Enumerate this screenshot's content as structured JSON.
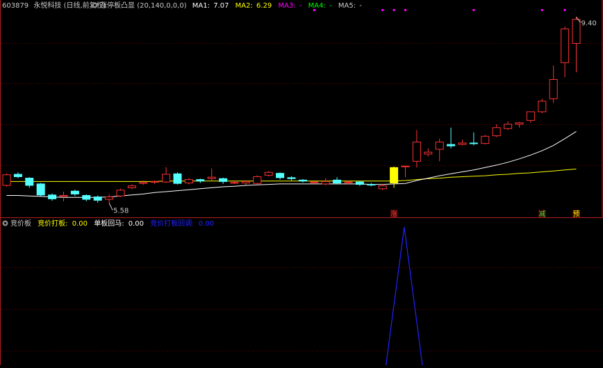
{
  "header": {
    "stock_code": "603879",
    "stock_name": "永悦科技",
    "period": "(日线,前复权)",
    "indicator_name": "涨停板凸显",
    "indicator_params": "(20,140,0,0,0)",
    "ma": [
      {
        "label": "MA1:",
        "value": "7.07",
        "color": "#ffffff"
      },
      {
        "label": "MA2:",
        "value": "6.29",
        "color": "#ffff00"
      },
      {
        "label": "MA3:",
        "value": "-",
        "color": "#ff00ff"
      },
      {
        "label": "MA4:",
        "value": "-",
        "color": "#00ff00"
      },
      {
        "label": "MA5:",
        "value": "-",
        "color": "#cccccc"
      }
    ]
  },
  "sub_header": {
    "name": "竞价板",
    "items": [
      {
        "label": "竞价打板:",
        "value": "0.00",
        "color": "#ffff00"
      },
      {
        "label": "单板回马:",
        "value": "0.00",
        "color": "#ffffff"
      },
      {
        "label": "竞价打板回调:",
        "value": "0.00",
        "color": "#2222ff"
      }
    ]
  },
  "colors": {
    "up": "#ff3232",
    "down": "#54ffff",
    "ma1": "#ffffff",
    "ma2": "#ffff00",
    "highlight": "#ffff00",
    "signal_line": "#2222ff",
    "panel_border": "#b41e1e",
    "grid": "#7a0000",
    "marker": "#ff00ff"
  },
  "chart_data": [
    {
      "type": "candlestick",
      "ylim": [
        5.3,
        9.6
      ],
      "annotations": {
        "low_label": "5.58",
        "high_label": "9.40"
      },
      "candles": [
        [
          5.95,
          6.17,
          5.92,
          6.2
        ],
        [
          6.18,
          6.13,
          6.1,
          6.22
        ],
        [
          6.1,
          5.95,
          5.9,
          6.12
        ],
        [
          5.98,
          5.75,
          5.72,
          6.0
        ],
        [
          5.75,
          5.67,
          5.63,
          5.78
        ],
        [
          5.72,
          5.74,
          5.62,
          5.82
        ],
        [
          5.83,
          5.77,
          5.73,
          5.86
        ],
        [
          5.74,
          5.66,
          5.62,
          5.76
        ],
        [
          5.71,
          5.64,
          5.59,
          5.74
        ],
        [
          5.66,
          5.71,
          5.58,
          5.76
        ],
        [
          5.73,
          5.85,
          5.71,
          5.88
        ],
        [
          5.9,
          5.94,
          5.87,
          5.97
        ],
        [
          5.99,
          6.01,
          5.96,
          6.05
        ],
        [
          6.02,
          6.03,
          5.98,
          6.05
        ],
        [
          6.02,
          6.18,
          6.0,
          6.33
        ],
        [
          6.19,
          5.99,
          5.97,
          6.22
        ],
        [
          6.0,
          6.07,
          5.97,
          6.1
        ],
        [
          6.07,
          6.04,
          6.0,
          6.09
        ],
        [
          6.09,
          6.12,
          6.05,
          6.3
        ],
        [
          6.09,
          6.03,
          5.98,
          6.11
        ],
        [
          6.01,
          6.01,
          5.98,
          6.04
        ],
        [
          6.0,
          6.03,
          5.96,
          6.05
        ],
        [
          5.99,
          6.13,
          5.97,
          6.16
        ],
        [
          6.16,
          6.22,
          6.13,
          6.25
        ],
        [
          6.2,
          6.11,
          6.07,
          6.22
        ],
        [
          6.11,
          6.09,
          6.05,
          6.14
        ],
        [
          6.06,
          6.04,
          6.01,
          6.08
        ],
        [
          6.01,
          6.02,
          5.98,
          6.03
        ],
        [
          5.98,
          6.03,
          5.95,
          6.1
        ],
        [
          6.06,
          6.0,
          5.97,
          6.12
        ],
        [
          6.01,
          6.02,
          5.97,
          6.04
        ],
        [
          6.02,
          5.97,
          5.94,
          6.04
        ],
        [
          5.97,
          5.96,
          5.93,
          6.0
        ],
        [
          5.88,
          5.94,
          5.85,
          5.98
        ],
        [
          6.0,
          6.32,
          5.9,
          6.34
        ],
        [
          6.34,
          6.35,
          6.12,
          6.35
        ],
        [
          6.45,
          6.85,
          6.32,
          7.1
        ],
        [
          6.6,
          6.64,
          6.55,
          6.72
        ],
        [
          6.7,
          6.85,
          6.45,
          6.92
        ],
        [
          6.8,
          6.77,
          6.72,
          7.15
        ],
        [
          6.8,
          6.83,
          6.78,
          6.9
        ],
        [
          6.83,
          6.82,
          6.78,
          7.05
        ],
        [
          6.82,
          6.97,
          6.8,
          7.0
        ],
        [
          6.98,
          7.15,
          6.95,
          7.22
        ],
        [
          7.13,
          7.22,
          7.1,
          7.28
        ],
        [
          7.22,
          7.25,
          7.15,
          7.27
        ],
        [
          7.3,
          7.48,
          7.25,
          7.48
        ],
        [
          7.48,
          7.7,
          7.45,
          7.75
        ],
        [
          7.75,
          8.15,
          7.66,
          8.44
        ],
        [
          8.5,
          9.2,
          8.2,
          9.25
        ],
        [
          8.9,
          9.4,
          8.3,
          9.45
        ]
      ],
      "ma1": [
        5.74,
        5.74,
        5.73,
        5.72,
        5.71,
        5.7,
        5.7,
        5.7,
        5.7,
        5.71,
        5.73,
        5.75,
        5.77,
        5.8,
        5.82,
        5.84,
        5.86,
        5.88,
        5.9,
        5.92,
        5.93,
        5.95,
        5.96,
        5.97,
        5.98,
        5.98,
        5.98,
        5.98,
        5.98,
        5.98,
        5.98,
        5.98,
        5.97,
        5.97,
        5.98,
        5.99,
        6.05,
        6.1,
        6.15,
        6.19,
        6.23,
        6.27,
        6.32,
        6.37,
        6.43,
        6.5,
        6.58,
        6.67,
        6.78,
        6.92,
        7.07
      ],
      "ma2": [
        6.03,
        6.03,
        6.03,
        6.03,
        6.03,
        6.03,
        6.03,
        6.03,
        6.03,
        6.03,
        6.03,
        6.03,
        6.03,
        6.03,
        6.04,
        6.04,
        6.04,
        6.04,
        6.04,
        6.04,
        6.04,
        6.04,
        6.04,
        6.04,
        6.04,
        6.04,
        6.04,
        6.04,
        6.04,
        6.04,
        6.04,
        6.04,
        6.04,
        6.04,
        6.04,
        6.05,
        6.07,
        6.09,
        6.1,
        6.12,
        6.13,
        6.14,
        6.15,
        6.17,
        6.18,
        6.2,
        6.21,
        6.23,
        6.25,
        6.27,
        6.29
      ],
      "highlight_index": 34,
      "top_marker_indices": [
        27,
        33,
        34,
        35,
        41,
        47,
        49
      ],
      "bottom_labels": [
        {
          "index": 34,
          "text": "涨",
          "color": "#ff4040"
        },
        {
          "index": 47,
          "text": "减",
          "color": "#40e040"
        },
        {
          "index": 50,
          "text": "预",
          "color": "#ffff00"
        }
      ]
    },
    {
      "type": "line",
      "series": [
        {
          "name": "竞价打板回调",
          "x": [
            33.3,
            34.9,
            36.5
          ],
          "values": [
            0,
            1,
            0
          ]
        }
      ],
      "ylim": [
        0,
        1
      ]
    }
  ]
}
